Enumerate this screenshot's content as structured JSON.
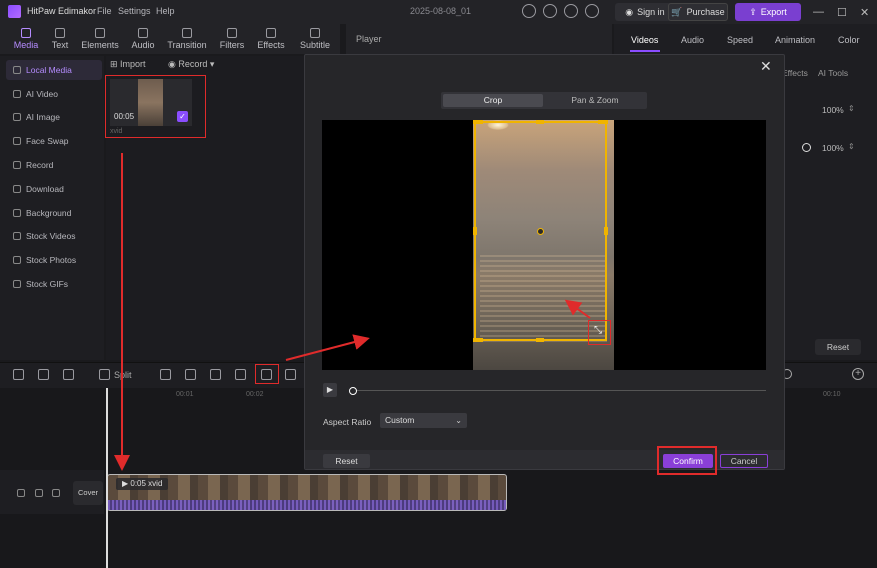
{
  "titlebar": {
    "app_name": "HitPaw Edimakor",
    "menus": [
      "File",
      "Settings",
      "Help"
    ],
    "date_title": "2025-08-08_01",
    "signin": "Sign in",
    "purchase": "Purchase",
    "export": "Export"
  },
  "tooltabs": [
    "Media",
    "Text",
    "Elements",
    "Audio",
    "Transition",
    "Filters",
    "Effects",
    "Subtitle"
  ],
  "sidebar": {
    "items": [
      "Local Media",
      "AI Video",
      "AI Image",
      "Face Swap",
      "Record",
      "Download",
      "Background",
      "Stock Videos",
      "Stock Photos",
      "Stock GIFs"
    ]
  },
  "media": {
    "import": "Import",
    "record": "Record",
    "thumb_duration": "00:05",
    "thumb_name": "xvid"
  },
  "player": {
    "label": "Player"
  },
  "right_panel": {
    "tabs": [
      "Videos",
      "Audio",
      "Speed",
      "Animation",
      "Color"
    ],
    "subtabs": [
      "Effects",
      "AI Tools"
    ],
    "pct1": "100%",
    "pct2": "100%",
    "reset": "Reset"
  },
  "timeline": {
    "split": "Split",
    "ruler": [
      "00:01",
      "00:02",
      "00:10"
    ],
    "cover": "Cover",
    "clip_label": "0:05 xvid"
  },
  "modal": {
    "tab_crop": "Crop",
    "tab_pan": "Pan & Zoom",
    "aspect_label": "Aspect Ratio",
    "aspect_value": "Custom",
    "reset": "Reset",
    "confirm": "Confirm",
    "cancel": "Cancel",
    "progress": 0
  },
  "colors": {
    "accent": "#8a3fd8",
    "crop_handle": "#f0b400",
    "annotation": "#e02b2b"
  }
}
